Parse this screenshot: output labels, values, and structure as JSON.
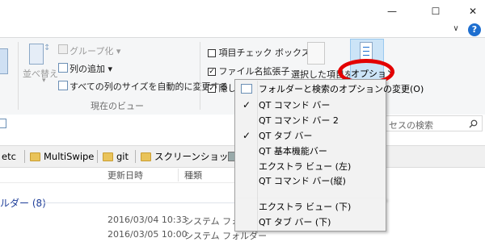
{
  "window": {
    "minimize_glyph": "—",
    "maximize_glyph": "☐",
    "close_glyph": "✕",
    "collapse_glyph": "∨",
    "help_glyph": "?"
  },
  "ribbon": {
    "sort_label": "並べ替え",
    "group_by_label": "グループ化",
    "add_column_label": "列の追加",
    "size_all_columns_label": "すべての列のサイズを自動的に変更する",
    "current_view_label": "現在のビュー",
    "item_checkbox_label": "項目チェック ボックス",
    "file_extension_label": "ファイル名拡張子",
    "hidden_items_label": "隠し",
    "hide_selected_label": "選択した項目を",
    "options_label": "オプション",
    "dropdown_glyph": "▾"
  },
  "search": {
    "placeholder_visible": "セスの検索",
    "icon": "search-icon"
  },
  "tabs": [
    {
      "label": "etc"
    },
    {
      "label": "MultiSwipe"
    },
    {
      "label": "git"
    },
    {
      "label": "スクリーンショット"
    }
  ],
  "columns": {
    "modified": "更新日時",
    "type": "種類"
  },
  "group": {
    "label": "ルダー (8)"
  },
  "rows": [
    {
      "date": "2016/03/04 10:33",
      "type": "システム フォルダー"
    },
    {
      "date": "2016/03/05 10:00",
      "type": "システム フォルダー"
    }
  ],
  "menu": {
    "items": [
      {
        "label": "フォルダーと検索のオプションの変更(O)",
        "checked": false
      },
      {
        "label": "QT コマンド バー",
        "checked": true
      },
      {
        "label": "QT コマンド バー 2",
        "checked": false
      },
      {
        "label": "QT タブ バー",
        "checked": true
      },
      {
        "label": "QT 基本機能バー",
        "checked": false
      },
      {
        "label": "エクストラ ビュー (左)",
        "checked": false
      },
      {
        "label": "QT コマンド バー(縦)",
        "checked": false
      },
      {
        "label": "エクストラ ビュー (下)",
        "checked": false
      },
      {
        "label": "QT タブ バー (下)",
        "checked": false
      }
    ],
    "check_glyph": "✓"
  },
  "colors": {
    "highlight_oval": "#e30000",
    "group_text": "#1e3e99",
    "help_blue": "#1e6fd0"
  }
}
